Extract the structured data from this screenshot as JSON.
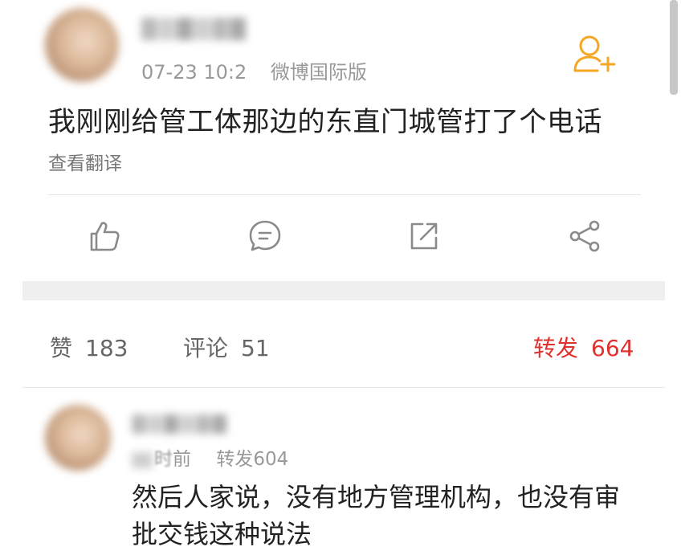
{
  "post": {
    "time": "07-23 10:2",
    "source": "微博国际版",
    "text": "我刚刚给管工体那边的东直门城管打了个电话",
    "translate_label": "查看翻译"
  },
  "stats": {
    "likes_label": "赞",
    "likes_count": "183",
    "comments_label": "评论",
    "comments_count": "51",
    "reposts_label": "转发",
    "reposts_count": "664"
  },
  "repost": {
    "ago": "前",
    "repost_info": "转发604",
    "text": "然后人家说，没有地方管理机构，也没有审批交钱这种说法"
  },
  "colors": {
    "accent_orange": "#f5a623",
    "repost_red": "#e0322d",
    "icon_gray": "#8a8a8a"
  },
  "icons": [
    "add-user-icon",
    "like-icon",
    "comment-icon",
    "repost-icon",
    "share-icon"
  ]
}
